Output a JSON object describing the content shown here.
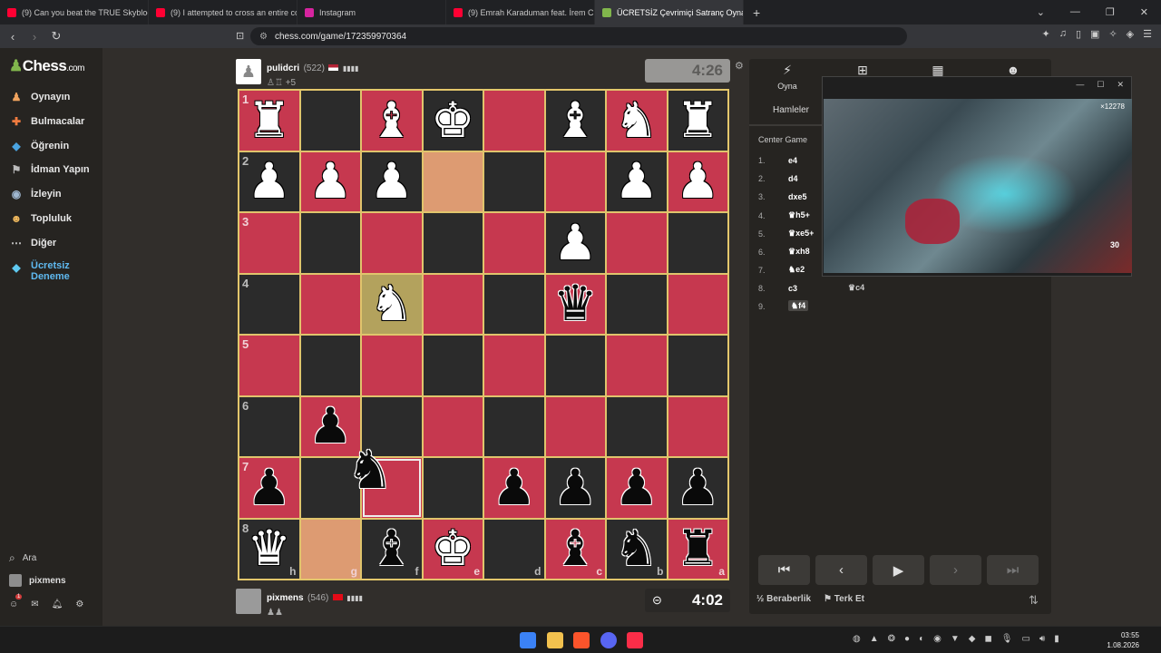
{
  "browser": {
    "tabs": [
      {
        "title": "(9) Can you beat the TRUE Skyblock?",
        "favicon_color": "#ff0033"
      },
      {
        "title": "(9) I attempted to cross an entire co...",
        "favicon_color": "#ff0033"
      },
      {
        "title": "Instagram",
        "favicon_color": "#d6249f"
      },
      {
        "title": "(9) Emrah Karaduman feat. İrem C...",
        "favicon_color": "#ff0033"
      },
      {
        "title": "ÜCRETSİZ Çevrimiçi Satranç Oyna...",
        "favicon_color": "#81b64c"
      }
    ],
    "url": "chess.com/game/172359970364"
  },
  "sidebar": {
    "logo": "Chess",
    "logo_suffix": ".com",
    "items": [
      {
        "label": "Oynayın",
        "icon": "play-pawn-icon"
      },
      {
        "label": "Bulmacalar",
        "icon": "puzzle-icon"
      },
      {
        "label": "Öğrenin",
        "icon": "learn-cap-icon"
      },
      {
        "label": "İdman Yapın",
        "icon": "train-icon"
      },
      {
        "label": "İzleyin",
        "icon": "watch-binoculars-icon"
      },
      {
        "label": "Topluluk",
        "icon": "community-icon"
      },
      {
        "label": "Diğer",
        "icon": "more-dots-icon"
      }
    ],
    "trial_line1": "Ücretsiz",
    "trial_line2": "Deneme",
    "search": "Ara",
    "username": "pixmens",
    "notif_count": "1"
  },
  "top_player": {
    "name": "pulidcri",
    "rating": "(522)",
    "captures": "+5",
    "clock": "4:26"
  },
  "bottom_player": {
    "name": "pixmens",
    "rating": "(546)",
    "clock": "4:02"
  },
  "board": {
    "ranks": [
      "1",
      "2",
      "3",
      "4",
      "5",
      "6",
      "7",
      "8"
    ],
    "files": [
      "h",
      "g",
      "f",
      "e",
      "d",
      "c",
      "b",
      "a"
    ],
    "pieces": [
      [
        "wR",
        "",
        "wB",
        "wK",
        "",
        "wB",
        "wN",
        "wR"
      ],
      [
        "wP",
        "wP",
        "wP",
        "",
        "",
        "",
        "wP",
        "wP"
      ],
      [
        "",
        "",
        "",
        "",
        "",
        "wP",
        "",
        ""
      ],
      [
        "",
        "",
        "wN",
        "",
        "",
        "bQ",
        "",
        ""
      ],
      [
        "",
        "",
        "",
        "",
        "",
        "",
        "",
        ""
      ],
      [
        "",
        "bP",
        "",
        "",
        "",
        "",
        "",
        ""
      ],
      [
        "bP",
        "",
        "",
        "",
        "bP",
        "bP",
        "bP",
        "bP"
      ],
      [
        "wQ",
        "",
        "bB",
        "wK",
        "",
        "bB",
        "bN",
        "bR"
      ]
    ]
  },
  "panel": {
    "tabs": [
      "Oyna",
      "",
      "",
      ""
    ],
    "moves_tab": "Hamleler",
    "opening": "Center Game",
    "moves": [
      {
        "n": "1.",
        "w": "e4",
        "b": ""
      },
      {
        "n": "2.",
        "w": "d4",
        "b": ""
      },
      {
        "n": "3.",
        "w": "dxe5",
        "b": ""
      },
      {
        "n": "4.",
        "w": "♛h5+",
        "b": ""
      },
      {
        "n": "5.",
        "w": "♛xe5+",
        "b": ""
      },
      {
        "n": "6.",
        "w": "♛xh8",
        "b": ""
      },
      {
        "n": "7.",
        "w": "♞e2",
        "b": ""
      },
      {
        "n": "8.",
        "w": "c3",
        "b": "♛c4"
      },
      {
        "n": "9.",
        "w": "♞f4",
        "b": ""
      }
    ],
    "draw": "½ Beraberlik",
    "resign": "Terk Et"
  },
  "video": {
    "hud_top": "×12278",
    "hud_count": "30"
  },
  "taskbar": {
    "time": "03:55",
    "date": "1.08.2026"
  }
}
